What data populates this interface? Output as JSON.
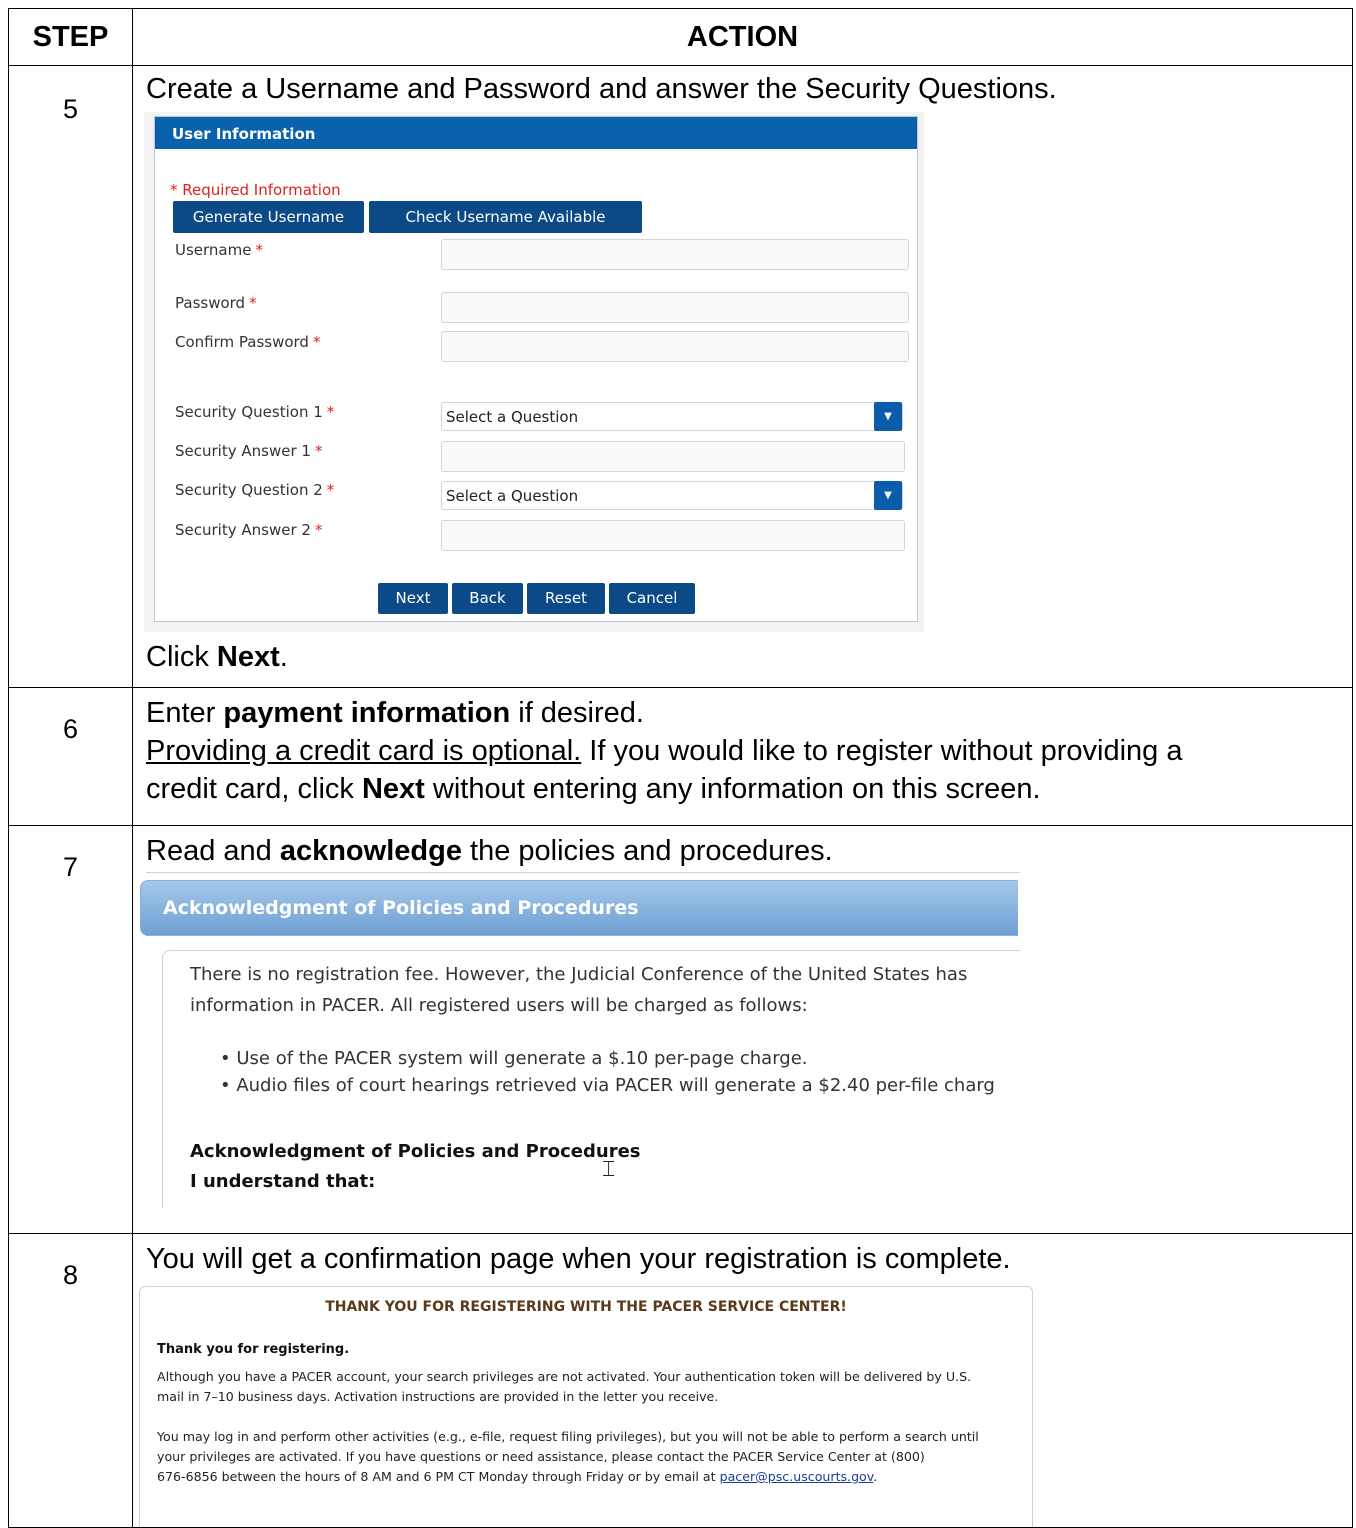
{
  "table": {
    "header_step": "STEP",
    "header_action": "ACTION"
  },
  "step5": {
    "num": "5",
    "intro": "Create a Username and Password and answer the Security Questions.",
    "click_prefix": "Click ",
    "click_bold": "Next",
    "click_suffix": ".",
    "form": {
      "panel_title": "User Information",
      "required_note": "* Required Information",
      "generate_button": "Generate Username",
      "check_button": "Check Username Available",
      "fields": {
        "username": "Username",
        "password": "Password",
        "confirm_password": "Confirm Password",
        "security_question_1": "Security Question 1",
        "security_answer_1": "Security Answer 1",
        "security_question_2": "Security Question 2",
        "security_answer_2": "Security Answer 2"
      },
      "required_marker": "*",
      "select_placeholder": "Select a Question",
      "buttons": {
        "next": "Next",
        "back": "Back",
        "reset": "Reset",
        "cancel": "Cancel"
      }
    }
  },
  "step6": {
    "num": "6",
    "line1_prefix": "Enter ",
    "line1_bold": "payment information",
    "line1_suffix": " if desired.",
    "line2_underlined": "Providing a credit card is optional.",
    "line2_rest": " If you would like to register without providing a",
    "line3_prefix": "credit card, click ",
    "line3_bold": "Next",
    "line3_suffix": " without entering any information on this screen."
  },
  "step7": {
    "num": "7",
    "line_prefix": "Read and ",
    "line_bold": "acknowledge",
    "line_suffix": " the policies and procedures.",
    "screen": {
      "header": "Acknowledgment of Policies and Procedures",
      "para_line1": "There is no registration fee. However, the Judicial Conference of the United States has",
      "para_line2": "information in PACER. All registered users will be charged as follows:",
      "bullet1": "• Use of the PACER system will generate a $.10 per-page charge.",
      "bullet2": "• Audio files of court hearings retrieved via PACER will generate a $2.40 per-file charg",
      "heading": "Acknowledgment of Policies and Procedures",
      "subheading": "I understand that:"
    }
  },
  "step8": {
    "num": "8",
    "line": "You will get a confirmation page when your registration is complete.",
    "screen": {
      "title": "THANK YOU FOR REGISTERING WITH THE PACER SERVICE CENTER!",
      "thanks": "Thank you for registering.",
      "p1_line1": "Although you have a PACER account, your search privileges are not activated. Your authentication token will be delivered by U.S.",
      "p1_line2": "mail in 7–10 business days. Activation instructions are provided in the letter you receive.",
      "p2_line1": "You may log in and perform other activities (e.g., e-file, request filing privileges), but you will not be able to perform a search until",
      "p2_line2": "your privileges are activated. If you have questions or need assistance, please contact the PACER Service Center at (800)",
      "p2_line3_prefix": "676-6856 between the hours of 8 AM and 6 PM CT Monday through Friday or by email at ",
      "p2_email": "pacer@psc.uscourts.gov",
      "p2_line3_suffix": "."
    }
  }
}
